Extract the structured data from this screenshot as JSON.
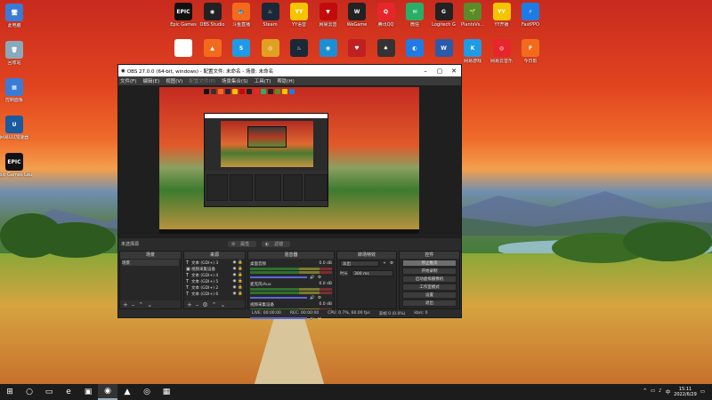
{
  "desktop": {
    "icons_top": [
      {
        "label": "Epic Games",
        "glyph": "EPIC",
        "color": "#111"
      },
      {
        "label": "OBS Studio",
        "glyph": "◉",
        "color": "#222"
      },
      {
        "label": "斗鱼直播",
        "glyph": "🐟",
        "color": "#f26b1d"
      },
      {
        "label": "Steam",
        "glyph": "♨",
        "color": "#1b2838"
      },
      {
        "label": "YY语音",
        "glyph": "YY",
        "color": "#f5c400"
      },
      {
        "label": "网易云音",
        "glyph": "▼",
        "color": "#c20c0c"
      },
      {
        "label": "WeGame",
        "glyph": "W",
        "color": "#222"
      },
      {
        "label": "腾讯QQ",
        "glyph": "Q",
        "color": "#e6262b"
      },
      {
        "label": "微信",
        "glyph": "✉",
        "color": "#2aae67"
      },
      {
        "label": "Logitech G",
        "glyph": "G",
        "color": "#222"
      },
      {
        "label": "PlantsVs...",
        "glyph": "🌱",
        "color": "#5a8a2a"
      },
      {
        "label": "YY开播",
        "glyph": "YY",
        "color": "#f5c400"
      },
      {
        "label": "FastPPO",
        "glyph": "⚡",
        "color": "#1e7be6"
      }
    ],
    "icons_second": [
      {
        "label": "",
        "glyph": "",
        "color": "#fff"
      },
      {
        "label": "",
        "glyph": "▲",
        "color": "#f26b1d"
      },
      {
        "label": "",
        "glyph": "S",
        "color": "#1e9be6"
      },
      {
        "label": "",
        "glyph": "◎",
        "color": "#e0a020"
      },
      {
        "label": "",
        "glyph": "♨",
        "color": "#1b2838"
      },
      {
        "label": "",
        "glyph": "◉",
        "color": "#1b8fd6"
      },
      {
        "label": "",
        "glyph": "♥",
        "color": "#c02020"
      },
      {
        "label": "",
        "glyph": "♠",
        "color": "#333"
      },
      {
        "label": "",
        "glyph": "◐",
        "color": "#1e7be6"
      },
      {
        "label": "",
        "glyph": "W",
        "color": "#2a5aaa"
      },
      {
        "label": "网易游戏",
        "glyph": "K",
        "color": "#1e9be6"
      },
      {
        "label": "网易云音乐",
        "glyph": "◎",
        "color": "#e6262b"
      },
      {
        "label": "今日影",
        "glyph": "F",
        "color": "#f26b1d"
      }
    ],
    "icons_left": [
      {
        "label": "此电脑",
        "glyph": "🖥",
        "color": "#3a7bd5"
      },
      {
        "label": "回收站",
        "glyph": "🗑",
        "color": "#8ab"
      },
      {
        "label": "控制面板",
        "glyph": "▦",
        "color": "#3a7bd5"
      },
      {
        "label": "网易UU加速器",
        "glyph": "U",
        "color": "#1a5aa0"
      },
      {
        "label": "Epic Games Launcher",
        "glyph": "EPIC",
        "color": "#111"
      }
    ]
  },
  "obs": {
    "title": "OBS 27.0.0 (64-bit, windows) - 配置文件: 未命名 - 场景: 未命名",
    "menu": [
      "文件(F)",
      "编辑(E)",
      "视图(V)",
      "配置文件(P)",
      "场景集合(S)",
      "工具(T)",
      "帮助(H)"
    ],
    "menu_disabled_index": 3,
    "scene_label": "未选择源",
    "scene_buttons": [
      "属性",
      "滤镜"
    ],
    "docks": {
      "scenes_title": "场景",
      "scenes": [
        "场景"
      ],
      "sources_title": "来源",
      "sources": [
        {
          "icon": "T",
          "name": "文本 (GDI+) 3"
        },
        {
          "icon": "▣",
          "name": "视频采集设备"
        },
        {
          "icon": "T",
          "name": "文本 (GDI+) 4"
        },
        {
          "icon": "T",
          "name": "文本 (GDI+) 5"
        },
        {
          "icon": "T",
          "name": "文本 (GDI+) 2"
        },
        {
          "icon": "T",
          "name": "文本 (GDI+) 6"
        }
      ],
      "mixer_title": "混音器",
      "mixer": [
        {
          "name": "桌面音频",
          "db": "0.0 dB"
        },
        {
          "name": "麦克风/Aux",
          "db": "0.0 dB"
        },
        {
          "name": "视频采集设备",
          "db": "0.0 dB"
        }
      ],
      "transitions_title": "转场特效",
      "transition_type": "淡出",
      "duration_label": "时长",
      "duration_value": "300 ms",
      "controls_title": "控件",
      "controls": [
        "停止推流",
        "开始录制",
        "启动虚拟摄像机",
        "工作室模式",
        "设置",
        "退出"
      ]
    },
    "status": {
      "live": "LIVE: 00:00:00",
      "rec": "REC: 00:00:00",
      "cpu": "CPU: 0.7%, 60.00 fps",
      "dropped": "丢帧 0 (0.0%)",
      "kbps": "kb/s: 0"
    }
  },
  "taskbar": {
    "start_glyph": "⊞",
    "items": [
      "○",
      "▭",
      "e",
      "▣",
      "◉",
      "▲",
      "◎",
      "▦"
    ],
    "active_index": 4,
    "tray": [
      "^",
      "▭",
      "♪",
      "中"
    ],
    "time": "15:11",
    "date": "2022/6/29"
  }
}
